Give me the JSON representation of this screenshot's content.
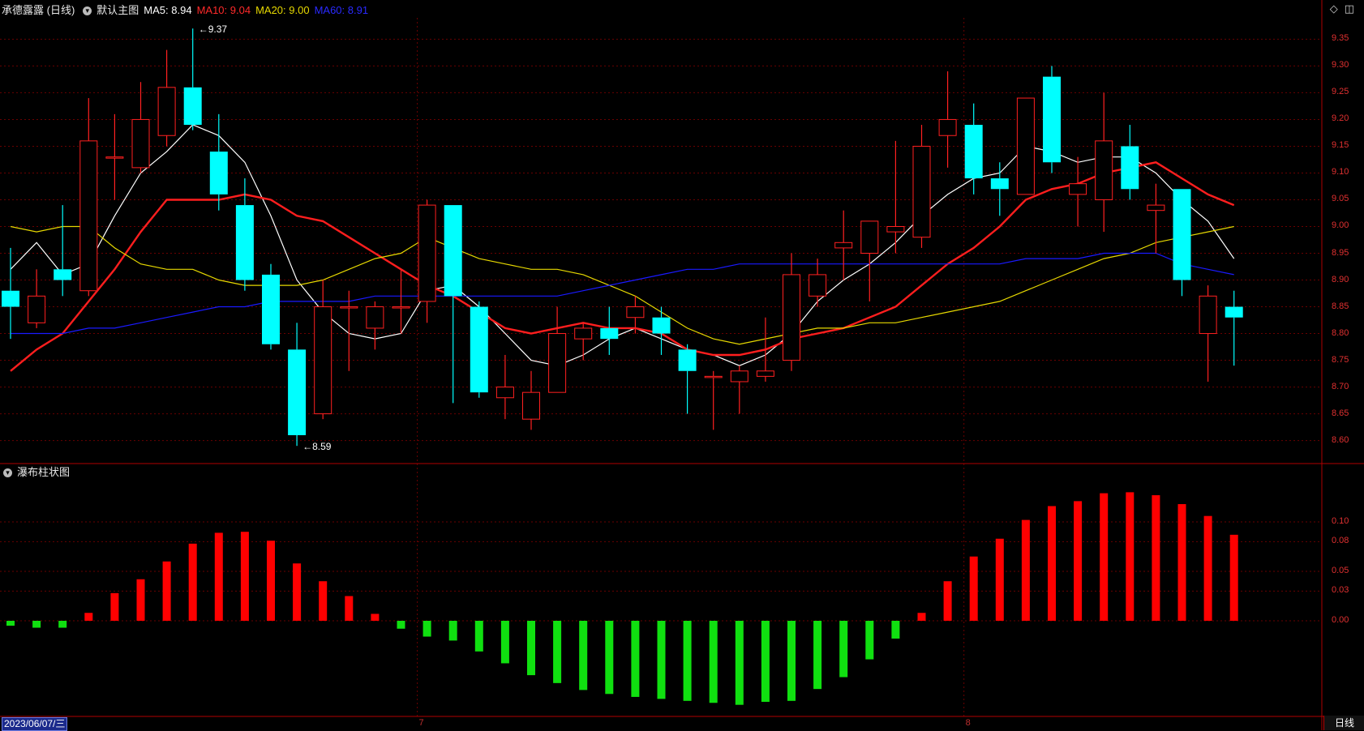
{
  "header": {
    "stock_name": "承德露露 (日线)",
    "main_chart_label": "默认主图",
    "ma5": "MA5: 8.94",
    "ma10": "MA10: 9.04",
    "ma20": "MA20: 9.00",
    "ma60": "MA60: 8.91"
  },
  "sub_panel": {
    "label": "瀑布柱状图"
  },
  "footer": {
    "date": "2023/06/07/三",
    "period_button": "日线"
  },
  "colors": {
    "up": "#ff2020",
    "down": "#00ffff",
    "ma5": "#ffffff",
    "ma10": "#ff1e1e",
    "ma20": "#e6d800",
    "ma60": "#1a1aff",
    "bar_pos": "#ff0000",
    "bar_neg": "#10e010",
    "grid": "#6a0000",
    "axis": "#b00000"
  },
  "icons": [
    "diamond-icon",
    "window-toggle-icon",
    "collapse-circle-icon"
  ],
  "chart_data": [
    {
      "type": "candlestick",
      "y_ticks": [
        "9.35",
        "9.30",
        "9.25",
        "9.20",
        "9.15",
        "9.10",
        "9.05",
        "9.00",
        "8.95",
        "8.90",
        "8.85",
        "8.80",
        "8.75",
        "8.70",
        "8.65",
        "8.60"
      ],
      "ylim": [
        8.56,
        9.39
      ],
      "x_labels": [
        {
          "index": 16,
          "label": "7"
        },
        {
          "index": 37,
          "label": "8"
        }
      ],
      "annotations": [
        {
          "index": 7,
          "value": 9.37,
          "text": "9.37"
        },
        {
          "index": 11,
          "value": 8.59,
          "text": "8.59"
        }
      ],
      "candles": [
        [
          8.88,
          8.85,
          8.96,
          8.79
        ],
        [
          8.82,
          8.87,
          8.92,
          8.81
        ],
        [
          8.92,
          8.9,
          9.04,
          8.87
        ],
        [
          8.88,
          9.16,
          9.24,
          8.87
        ],
        [
          9.13,
          9.13,
          9.21,
          9.05
        ],
        [
          9.11,
          9.2,
          9.27,
          9.1
        ],
        [
          9.17,
          9.26,
          9.33,
          9.15
        ],
        [
          9.26,
          9.19,
          9.37,
          9.18
        ],
        [
          9.14,
          9.06,
          9.21,
          9.03
        ],
        [
          9.04,
          8.9,
          9.09,
          8.88
        ],
        [
          8.91,
          8.78,
          8.93,
          8.77
        ],
        [
          8.77,
          8.61,
          8.82,
          8.59
        ],
        [
          8.65,
          8.85,
          8.9,
          8.64
        ],
        [
          8.85,
          8.85,
          8.88,
          8.73
        ],
        [
          8.81,
          8.85,
          8.86,
          8.77
        ],
        [
          8.85,
          8.85,
          8.92,
          8.8
        ],
        [
          8.86,
          9.04,
          9.05,
          8.82
        ],
        [
          9.04,
          8.87,
          9.04,
          8.67
        ],
        [
          8.85,
          8.69,
          8.86,
          8.68
        ],
        [
          8.68,
          8.7,
          8.76,
          8.64
        ],
        [
          8.64,
          8.69,
          8.73,
          8.62
        ],
        [
          8.69,
          8.8,
          8.85,
          8.69
        ],
        [
          8.79,
          8.81,
          8.82,
          8.75
        ],
        [
          8.81,
          8.79,
          8.85,
          8.76
        ],
        [
          8.83,
          8.85,
          8.87,
          8.8
        ],
        [
          8.83,
          8.8,
          8.85,
          8.76
        ],
        [
          8.77,
          8.73,
          8.78,
          8.65
        ],
        [
          8.72,
          8.72,
          8.73,
          8.62
        ],
        [
          8.71,
          8.73,
          8.74,
          8.65
        ],
        [
          8.72,
          8.73,
          8.83,
          8.71
        ],
        [
          8.75,
          8.91,
          8.95,
          8.73
        ],
        [
          8.87,
          8.91,
          8.94,
          8.85
        ],
        [
          8.96,
          8.97,
          9.03,
          8.9
        ],
        [
          8.95,
          9.01,
          9.01,
          8.86
        ],
        [
          8.99,
          9.0,
          9.16,
          8.95
        ],
        [
          8.98,
          9.15,
          9.19,
          8.96
        ],
        [
          9.17,
          9.2,
          9.29,
          9.11
        ],
        [
          9.19,
          9.09,
          9.23,
          9.06
        ],
        [
          9.09,
          9.07,
          9.12,
          9.02
        ],
        [
          9.06,
          9.24,
          9.24,
          9.06
        ],
        [
          9.28,
          9.12,
          9.3,
          9.1
        ],
        [
          9.06,
          9.08,
          9.13,
          9.0
        ],
        [
          9.05,
          9.16,
          9.25,
          8.99
        ],
        [
          9.15,
          9.07,
          9.19,
          9.05
        ],
        [
          9.03,
          9.04,
          9.08,
          8.95
        ],
        [
          9.07,
          8.9,
          9.07,
          8.87
        ],
        [
          8.8,
          8.87,
          8.89,
          8.71
        ],
        [
          8.85,
          8.83,
          8.88,
          8.74
        ]
      ],
      "series": [
        {
          "name": "MA5",
          "values": [
            8.92,
            8.97,
            8.91,
            8.93,
            9.02,
            9.1,
            9.14,
            9.19,
            9.17,
            9.12,
            9.02,
            8.9,
            8.84,
            8.8,
            8.79,
            8.8,
            8.88,
            8.89,
            8.85,
            8.8,
            8.75,
            8.74,
            8.76,
            8.79,
            8.81,
            8.79,
            8.77,
            8.76,
            8.74,
            8.76,
            8.8,
            8.86,
            8.9,
            8.93,
            8.97,
            9.02,
            9.06,
            9.09,
            9.1,
            9.15,
            9.14,
            9.12,
            9.13,
            9.13,
            9.1,
            9.05,
            9.01,
            8.94
          ]
        },
        {
          "name": "MA10",
          "values": [
            8.73,
            8.77,
            8.8,
            8.86,
            8.92,
            8.99,
            9.05,
            9.05,
            9.05,
            9.06,
            9.05,
            9.02,
            9.01,
            8.98,
            8.95,
            8.92,
            8.89,
            8.87,
            8.84,
            8.81,
            8.8,
            8.81,
            8.82,
            8.81,
            8.81,
            8.8,
            8.77,
            8.76,
            8.76,
            8.77,
            8.79,
            8.8,
            8.81,
            8.83,
            8.85,
            8.89,
            8.93,
            8.96,
            9.0,
            9.05,
            9.07,
            9.08,
            9.1,
            9.11,
            9.12,
            9.09,
            9.06,
            9.04
          ]
        },
        {
          "name": "MA20",
          "values": [
            9.0,
            8.99,
            9.0,
            9.0,
            8.96,
            8.93,
            8.92,
            8.92,
            8.9,
            8.89,
            8.89,
            8.89,
            8.9,
            8.92,
            8.94,
            8.95,
            8.98,
            8.96,
            8.94,
            8.93,
            8.92,
            8.92,
            8.91,
            8.89,
            8.87,
            8.84,
            8.81,
            8.79,
            8.78,
            8.79,
            8.8,
            8.81,
            8.81,
            8.82,
            8.82,
            8.83,
            8.84,
            8.85,
            8.86,
            8.88,
            8.9,
            8.92,
            8.94,
            8.95,
            8.97,
            8.98,
            8.99,
            9.0
          ]
        },
        {
          "name": "MA60",
          "values": [
            8.8,
            8.8,
            8.8,
            8.81,
            8.81,
            8.82,
            8.83,
            8.84,
            8.85,
            8.85,
            8.86,
            8.86,
            8.86,
            8.86,
            8.87,
            8.87,
            8.87,
            8.87,
            8.87,
            8.87,
            8.87,
            8.87,
            8.88,
            8.89,
            8.9,
            8.91,
            8.92,
            8.92,
            8.93,
            8.93,
            8.93,
            8.93,
            8.93,
            8.93,
            8.93,
            8.93,
            8.93,
            8.93,
            8.93,
            8.94,
            8.94,
            8.94,
            8.95,
            8.95,
            8.95,
            8.93,
            8.92,
            8.91
          ]
        }
      ]
    },
    {
      "type": "bar",
      "title": "瀑布柱状图",
      "y_ticks": [
        "0.10",
        "0.08",
        "0.05",
        "0.03",
        "0.00"
      ],
      "ylim": [
        -0.09,
        0.135
      ],
      "values": [
        -0.005,
        -0.007,
        -0.007,
        0.008,
        0.028,
        0.042,
        0.06,
        0.078,
        0.089,
        0.09,
        0.081,
        0.058,
        0.04,
        0.025,
        0.007,
        -0.008,
        -0.016,
        -0.02,
        -0.031,
        -0.043,
        -0.055,
        -0.063,
        -0.07,
        -0.074,
        -0.077,
        -0.079,
        -0.081,
        -0.083,
        -0.085,
        -0.082,
        -0.081,
        -0.069,
        -0.057,
        -0.039,
        -0.018,
        0.008,
        0.04,
        0.065,
        0.083,
        0.102,
        0.116,
        0.121,
        0.129,
        0.13,
        0.127,
        0.118,
        0.106,
        0.087
      ]
    }
  ]
}
